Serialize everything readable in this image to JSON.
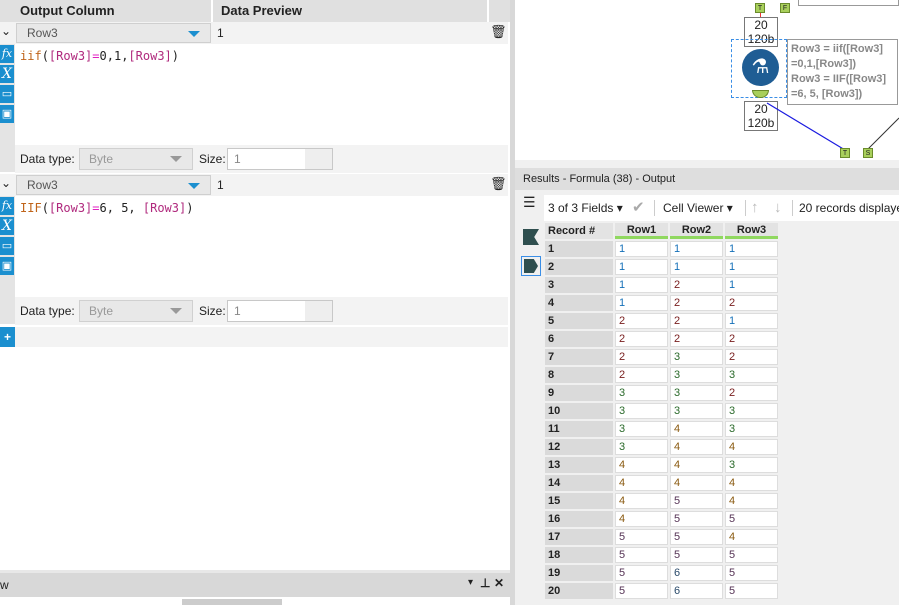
{
  "left": {
    "headers": {
      "output_column": "Output Column",
      "data_preview": "Data Preview"
    },
    "formulas": [
      {
        "field": "Row3",
        "preview": "1",
        "expr": [
          [
            "kw",
            "iif"
          ],
          [
            "p",
            "("
          ],
          [
            "fld",
            "[Row3]"
          ],
          [
            "op",
            "="
          ],
          [
            "p",
            "0,1,"
          ],
          [
            "fld",
            "[Row3]"
          ],
          [
            "p",
            ")"
          ]
        ],
        "data_type_label": "Data type:",
        "data_type": "Byte",
        "size_label": "Size:",
        "size": "1"
      },
      {
        "field": "Row3",
        "preview": "1",
        "expr": [
          [
            "kw",
            "IIF"
          ],
          [
            "p",
            "("
          ],
          [
            "fld",
            "[Row3]"
          ],
          [
            "op",
            "="
          ],
          [
            "p",
            "6, 5, "
          ],
          [
            "fld",
            "[Row3]"
          ],
          [
            "p",
            ")"
          ]
        ],
        "data_type_label": "Data type:",
        "data_type": "Byte",
        "size_label": "Size:",
        "size": "1"
      }
    ],
    "bottom_panel_title": "w"
  },
  "canvas": {
    "top_anchors": [
      "T",
      "F"
    ],
    "node_in": {
      "records": "20",
      "size": "120b"
    },
    "node_out": {
      "records": "20",
      "size": "120b"
    },
    "annotation": [
      "Row3 = iif([Row3]",
      "=0,1,[Row3])",
      "Row3 = IIF([Row3]",
      "=6, 5, [Row3])"
    ],
    "bottom_anchors": [
      "T",
      "S"
    ]
  },
  "results": {
    "title": "Results - Formula (38) - Output",
    "fields": "3 of 3 Fields",
    "viewer": "Cell Viewer",
    "records_text": "20 records displaye",
    "columns": [
      "Record #",
      "Row1",
      "Row2",
      "Row3"
    ],
    "rows": [
      [
        1,
        1,
        1,
        1
      ],
      [
        2,
        1,
        1,
        1
      ],
      [
        3,
        1,
        2,
        1
      ],
      [
        4,
        1,
        2,
        2
      ],
      [
        5,
        2,
        2,
        1
      ],
      [
        6,
        2,
        2,
        2
      ],
      [
        7,
        2,
        3,
        2
      ],
      [
        8,
        2,
        3,
        3
      ],
      [
        9,
        3,
        3,
        2
      ],
      [
        10,
        3,
        3,
        3
      ],
      [
        11,
        3,
        4,
        3
      ],
      [
        12,
        3,
        4,
        4
      ],
      [
        13,
        4,
        4,
        3
      ],
      [
        14,
        4,
        4,
        4
      ],
      [
        15,
        4,
        5,
        4
      ],
      [
        16,
        4,
        5,
        5
      ],
      [
        17,
        5,
        5,
        4
      ],
      [
        18,
        5,
        5,
        5
      ],
      [
        19,
        5,
        6,
        5
      ],
      [
        20,
        5,
        6,
        5
      ]
    ]
  },
  "colors": {
    "accent": "#1b8fcf",
    "anchor": "#a8cf5b",
    "header_underline": "#90d860"
  }
}
